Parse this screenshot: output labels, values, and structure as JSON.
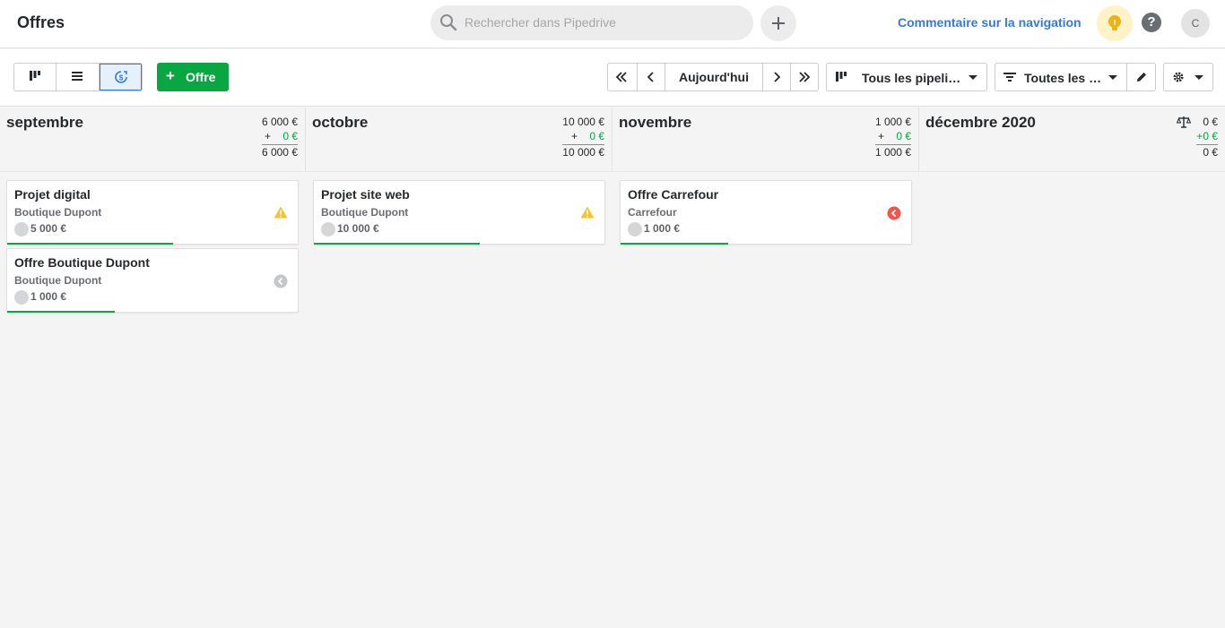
{
  "header": {
    "title": "Offres",
    "search_placeholder": "Rechercher dans Pipedrive",
    "nav_feedback": "Commentaire sur la navigation",
    "help_label": "?",
    "avatar_initial": "C"
  },
  "toolbar": {
    "add_offer_label": "Offre",
    "today_label": "Aujourd'hui",
    "pipeline_select": "Tous les pipeli…",
    "filter_select": "Toutes les …"
  },
  "colors": {
    "accent": "#317ae2",
    "success": "#08a742",
    "warning": "#f5c32c",
    "danger": "#f3554b",
    "neutral": "#c4c6c8"
  },
  "columns": [
    {
      "month": "septembre",
      "total": "6 000 €",
      "plus": "+",
      "added": "0 €",
      "sum": "6 000 €"
    },
    {
      "month": "octobre",
      "total": "10 000 €",
      "plus": "+",
      "added": "0 €",
      "sum": "10 000 €"
    },
    {
      "month": "novembre",
      "total": "1 000 €",
      "plus": "+",
      "added": "0 €",
      "sum": "1 000 €"
    },
    {
      "month": "décembre 2020",
      "total": "0 €",
      "plus": "+",
      "added": "0 €",
      "sum": "0 €",
      "icon": "scale-icon"
    }
  ],
  "cards": [
    {
      "title": "Projet digital",
      "org": "Boutique Dupont",
      "value": "5 000 €",
      "status": "warning-icon",
      "progress": 0.57
    },
    {
      "title": "Offre Boutique Dupont",
      "org": "Boutique Dupont",
      "value": "1 000 €",
      "status": "back-arrow-grey-icon",
      "progress": 0.37
    },
    {
      "title": "Projet site web",
      "org": "Boutique Dupont",
      "value": "10 000 €",
      "status": "warning-icon",
      "progress": 0.57
    },
    {
      "title": "Offre Carrefour",
      "org": "Carrefour",
      "value": "1 000 €",
      "status": "back-arrow-red-icon",
      "progress": 0.37
    }
  ]
}
